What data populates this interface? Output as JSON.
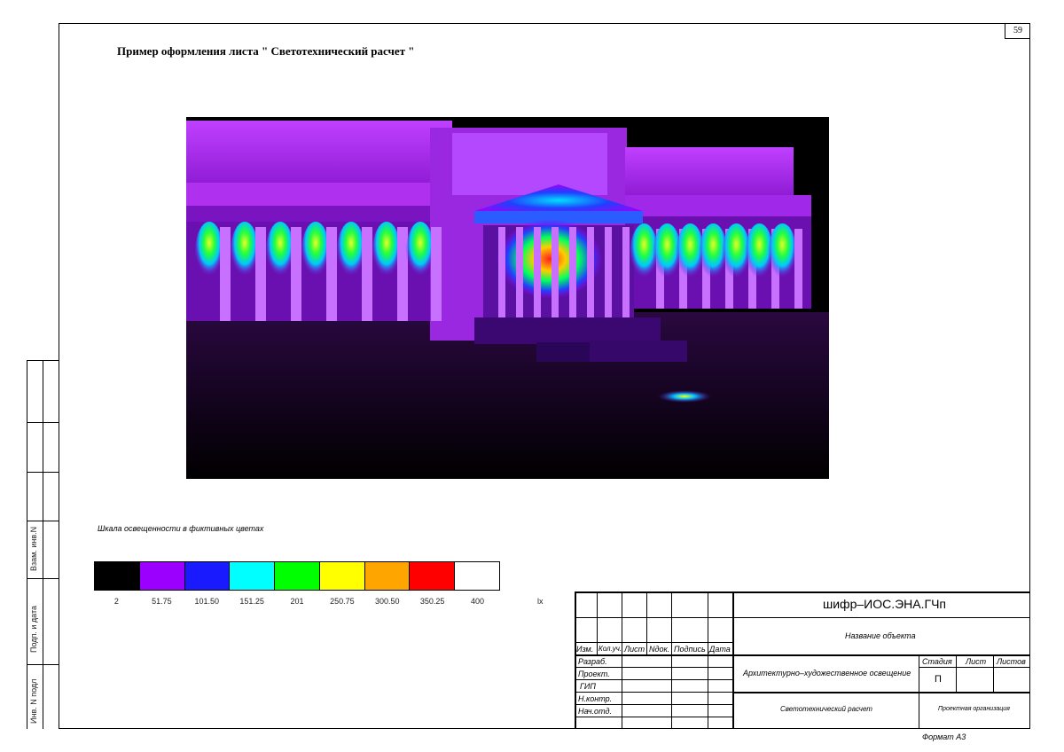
{
  "sheet_number": "59",
  "title": "Пример оформления листа \" Светотехнический расчет \"",
  "margin_labels": [
    "Инв. N подл",
    "Подп. и дата",
    "Взам. инв.N"
  ],
  "scale": {
    "title": "Шкала освещенности в фиктивных цветах",
    "unit": "lx",
    "colors": [
      "#000000",
      "#9b00ff",
      "#1a1aff",
      "#00ffff",
      "#00ff00",
      "#ffff00",
      "#ffa500",
      "#ff0000",
      "#ffffff"
    ],
    "labels": [
      "2",
      "51.75",
      "101.50",
      "151.25",
      "201",
      "250.75",
      "300.50",
      "350.25",
      "400"
    ]
  },
  "stamp": {
    "code": "шифр–ИОС.ЭНА.ГЧп",
    "object_name": "Название объекта",
    "headers": [
      "Изм.",
      "Кол.уч.",
      "Лист",
      "Nдок.",
      "Подпись",
      "Дата"
    ],
    "roles": [
      "Разраб.",
      "Проект.",
      "ГИП",
      "Н.контр.",
      "Нач.отд."
    ],
    "section": "Архитектурно–художественное освещение",
    "stage_label": "Стадия",
    "sheet_label": "Лист",
    "sheets_label": "Листов",
    "stage_value": "П",
    "drawing_name": "Светотехнический расчет",
    "organization": "Проектная организация",
    "format": "Формат А3"
  }
}
